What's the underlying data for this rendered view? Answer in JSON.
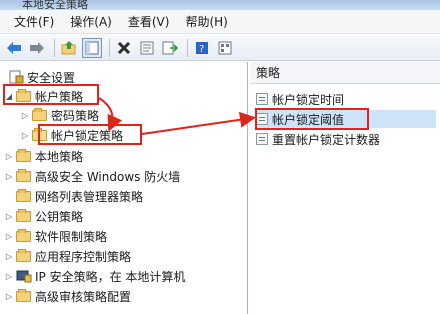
{
  "window": {
    "title": "本地安全策略"
  },
  "menubar": {
    "items": [
      "文件(F)",
      "操作(A)",
      "查看(V)",
      "帮助(H)"
    ]
  },
  "tree": {
    "root": "安全设置",
    "items": [
      {
        "label": "帐户策略",
        "level": 1,
        "expanded": true
      },
      {
        "label": "密码策略",
        "level": 2
      },
      {
        "label": "帐户锁定策略",
        "level": 2,
        "selected": true
      },
      {
        "label": "本地策略",
        "level": 1
      },
      {
        "label": "高级安全 Windows 防火墙",
        "level": 1
      },
      {
        "label": "网络列表管理器策略",
        "level": 1
      },
      {
        "label": "公钥策略",
        "level": 1
      },
      {
        "label": "软件限制策略",
        "level": 1
      },
      {
        "label": "应用程序控制策略",
        "level": 1
      },
      {
        "label": "IP 安全策略，在 本地计算机",
        "level": 1
      },
      {
        "label": "高级审核策略配置",
        "level": 1
      }
    ]
  },
  "right_pane": {
    "header": "策略",
    "items": [
      {
        "label": "帐户锁定时间"
      },
      {
        "label": "帐户锁定阈值",
        "selected": true
      },
      {
        "label": "重置帐户锁定计数器"
      }
    ]
  },
  "colors": {
    "annotation": "#e0241b",
    "selection": "#cfe3f8",
    "folder": "#f2d27a"
  }
}
